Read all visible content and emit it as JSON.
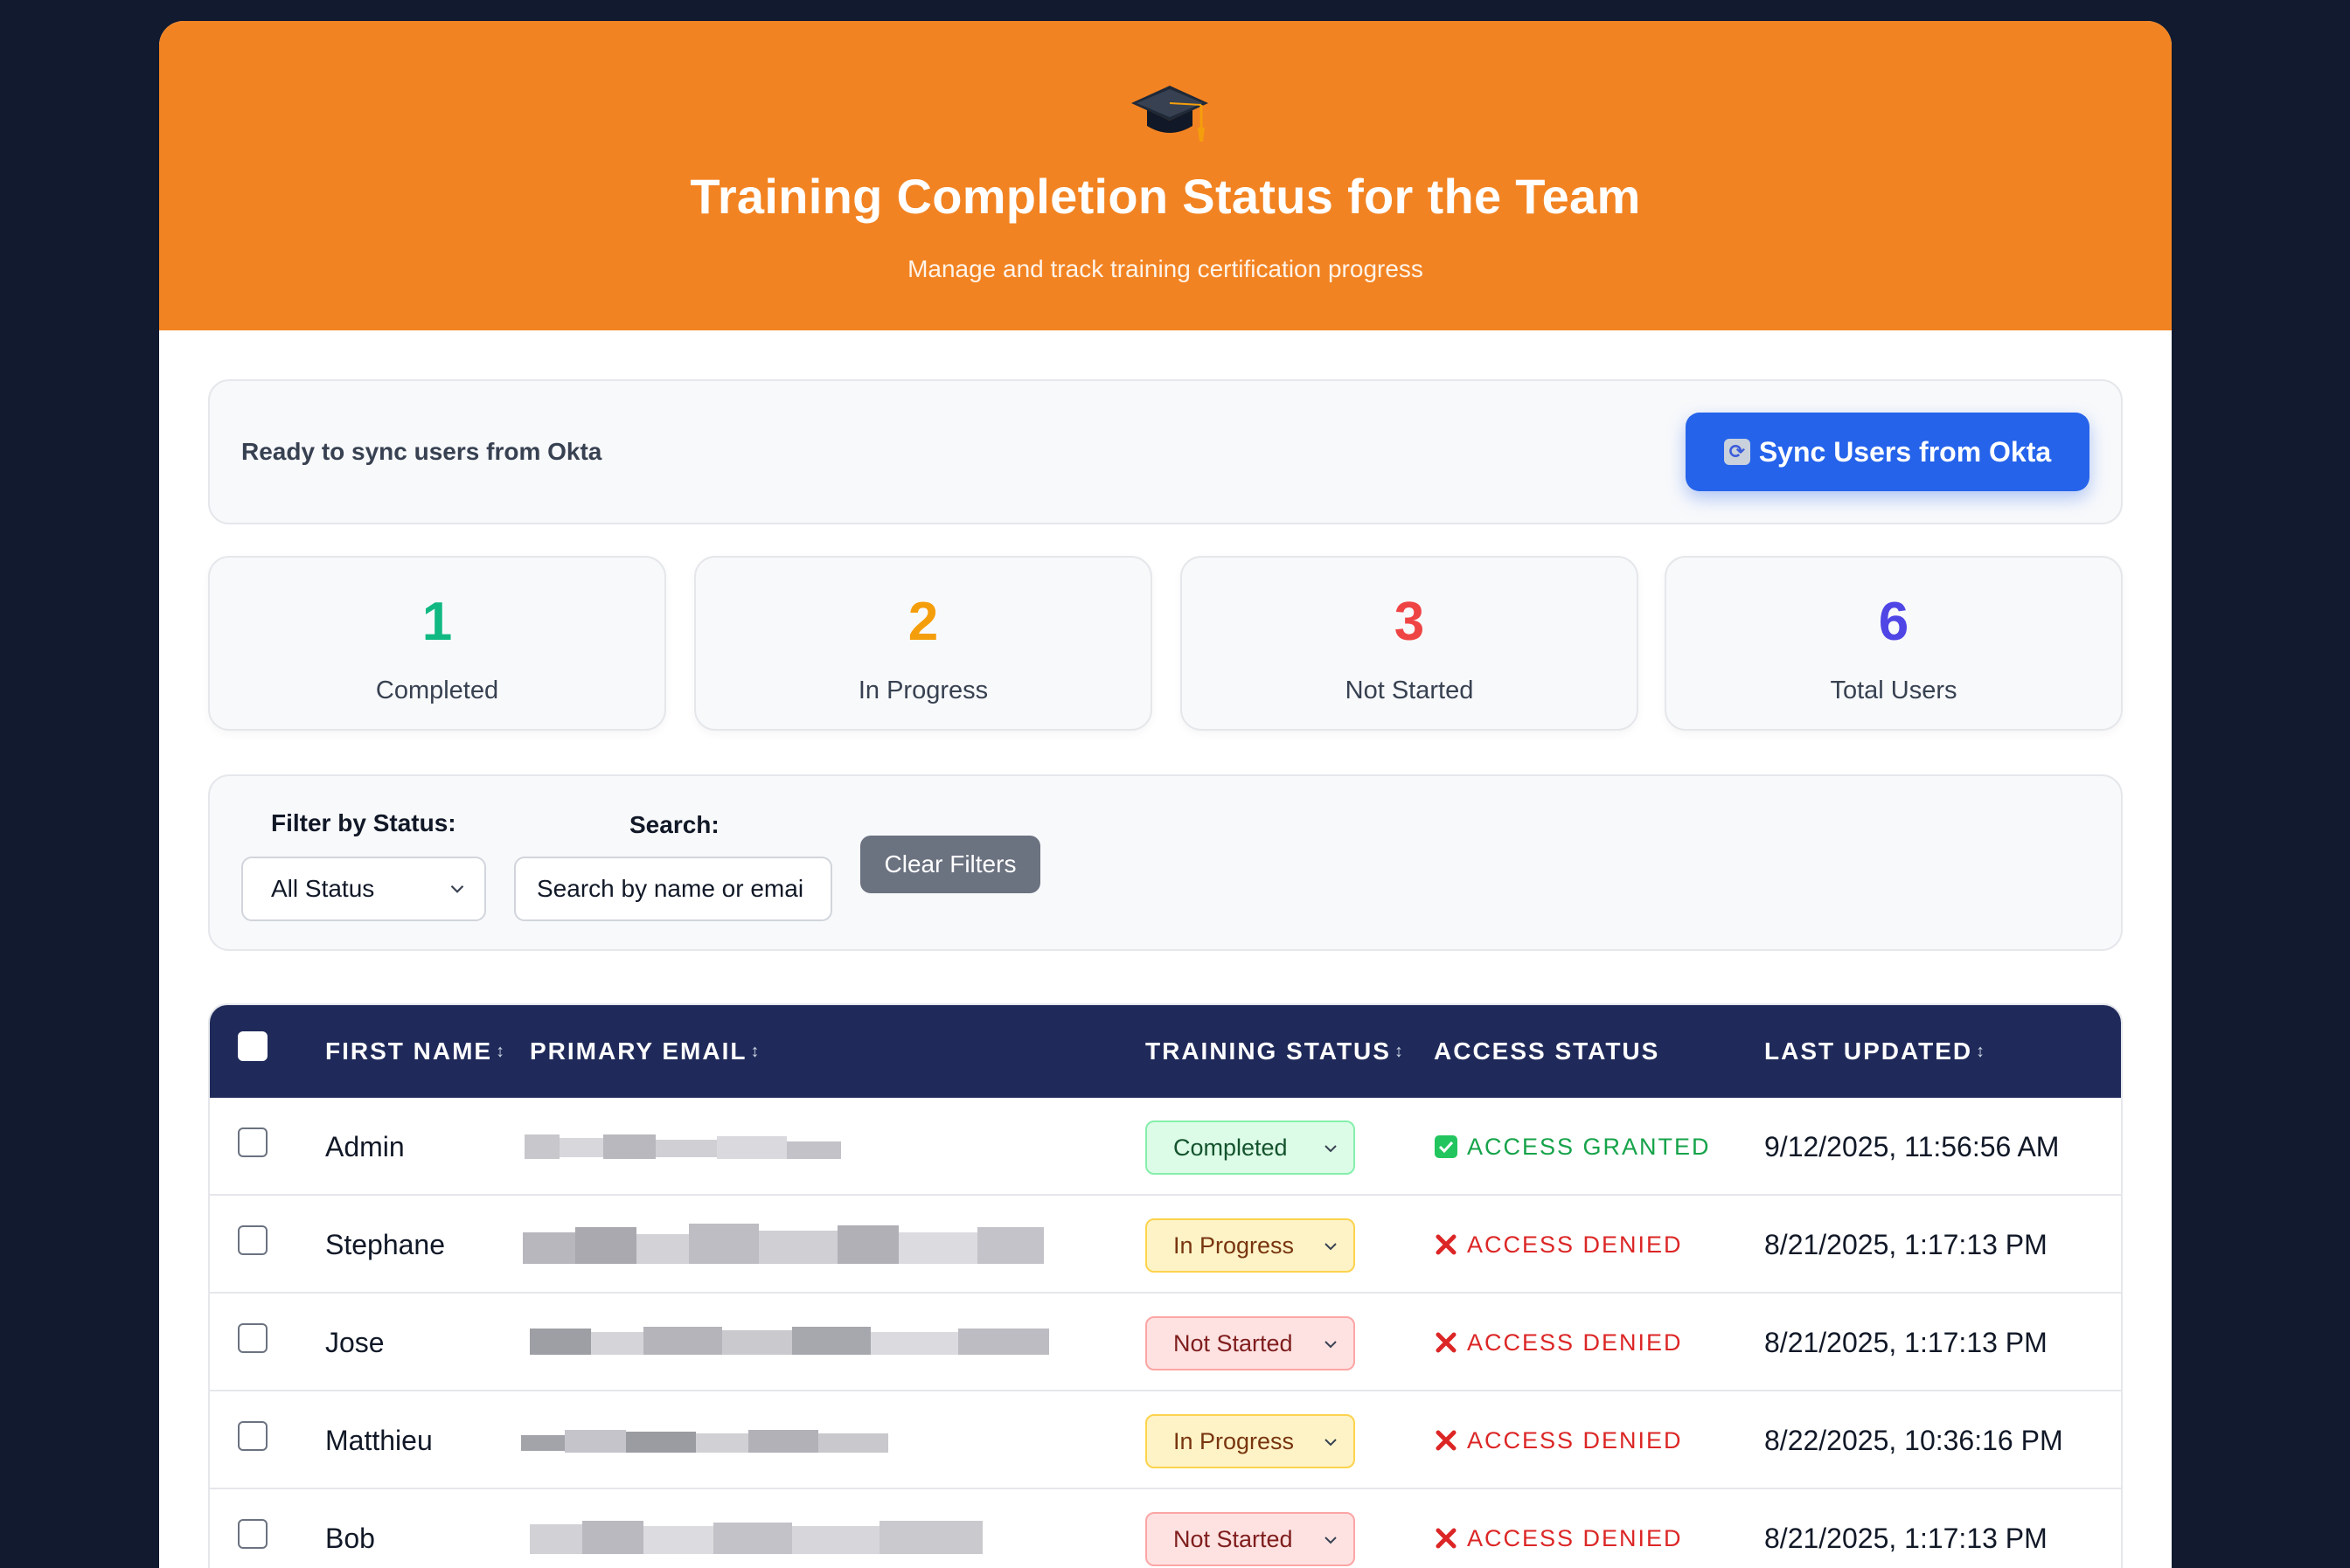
{
  "header": {
    "icon": "graduation-cap-icon",
    "title": "Training Completion Status for the Team",
    "subtitle": "Manage and track training certification progress"
  },
  "sync": {
    "status_text": "Ready to sync users from Okta",
    "button_label": "Sync Users from Okta",
    "button_icon": "refresh-icon"
  },
  "stats": [
    {
      "value": "1",
      "label": "Completed",
      "color": "#10b981"
    },
    {
      "value": "2",
      "label": "In Progress",
      "color": "#f59e0b"
    },
    {
      "value": "3",
      "label": "Not Started",
      "color": "#ef4444"
    },
    {
      "value": "6",
      "label": "Total Users",
      "color": "#4f46e5"
    }
  ],
  "filters": {
    "status_label": "Filter by Status:",
    "status_value": "All Status",
    "search_label": "Search:",
    "search_placeholder": "Search by name or emai",
    "clear_label": "Clear Filters"
  },
  "table": {
    "columns": {
      "first_name": "FIRST NAME",
      "email": "PRIMARY EMAIL",
      "training_status": "TRAINING STATUS",
      "access_status": "ACCESS STATUS",
      "last_updated": "LAST UPDATED"
    },
    "sort_glyph": "↕",
    "rows": [
      {
        "first_name": "Admin",
        "training_status": "Completed",
        "access": "ACCESS GRANTED",
        "updated": "9/12/2025, 11:56:56 AM"
      },
      {
        "first_name": "Stephane",
        "training_status": "In Progress",
        "access": "ACCESS DENIED",
        "updated": "8/21/2025, 1:17:13 PM"
      },
      {
        "first_name": "Jose",
        "training_status": "Not Started",
        "access": "ACCESS DENIED",
        "updated": "8/21/2025, 1:17:13 PM"
      },
      {
        "first_name": "Matthieu",
        "training_status": "In Progress",
        "access": "ACCESS DENIED",
        "updated": "8/22/2025, 10:36:16 PM"
      },
      {
        "first_name": "Bob",
        "training_status": "Not Started",
        "access": "ACCESS DENIED",
        "updated": "8/21/2025, 1:17:13 PM"
      }
    ]
  }
}
